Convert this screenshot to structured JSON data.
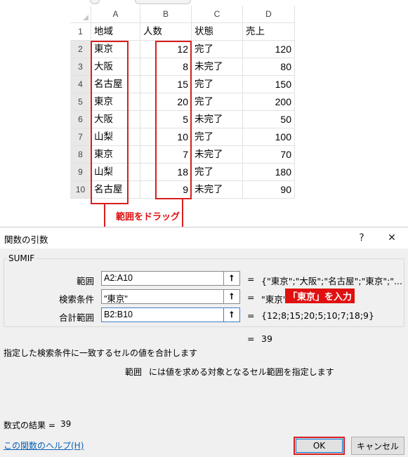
{
  "sheet": {
    "columns": [
      "A",
      "B",
      "C",
      "D"
    ],
    "rows": [
      {
        "num": "1",
        "a": "地域",
        "b": "人数",
        "c": "状態",
        "d": "売上"
      },
      {
        "num": "2",
        "a": "東京",
        "b": "12",
        "c": "完了",
        "d": "120"
      },
      {
        "num": "3",
        "a": "大阪",
        "b": "8",
        "c": "未完了",
        "d": "80"
      },
      {
        "num": "4",
        "a": "名古屋",
        "b": "15",
        "c": "完了",
        "d": "150"
      },
      {
        "num": "5",
        "a": "東京",
        "b": "20",
        "c": "完了",
        "d": "200"
      },
      {
        "num": "6",
        "a": "大阪",
        "b": "5",
        "c": "未完了",
        "d": "50"
      },
      {
        "num": "7",
        "a": "山梨",
        "b": "10",
        "c": "完了",
        "d": "100"
      },
      {
        "num": "8",
        "a": "東京",
        "b": "7",
        "c": "未完了",
        "d": "70"
      },
      {
        "num": "9",
        "a": "山梨",
        "b": "18",
        "c": "完了",
        "d": "180"
      },
      {
        "num": "10",
        "a": "名古屋",
        "b": "9",
        "c": "未完了",
        "d": "90"
      }
    ]
  },
  "annotation": {
    "drag_label": "範囲をドラッグ",
    "input_callout": "「東京」を入力",
    "highlight_color": "#d81e1e"
  },
  "dialog": {
    "title": "関数の引数",
    "help_button": "?",
    "close_button": "✕",
    "function_name": "SUMIF",
    "args": [
      {
        "label": "範囲",
        "value": "A2:A10",
        "result": "{\"東京\";\"大阪\";\"名古屋\";\"東京\";\"..."
      },
      {
        "label": "検索条件",
        "value": "\"東京\"",
        "result": "\"東京\""
      },
      {
        "label": "合計範囲",
        "value": "B2:B10",
        "result": "{12;8;15;20;5;10;7;18;9}"
      }
    ],
    "equals": "=",
    "overall_result": "39",
    "ref_icon": "upload-arrow-icon",
    "description": "指定した検索条件に一致するセルの値を合計します",
    "arg_help_name": "範囲",
    "arg_help_text": "には値を求める対象となるセル範囲を指定します",
    "formula_result_label": "数式の結果 =",
    "formula_result_value": "39",
    "help_link": "この関数のヘルプ(H)",
    "ok_label": "OK",
    "cancel_label": "キャンセル"
  }
}
